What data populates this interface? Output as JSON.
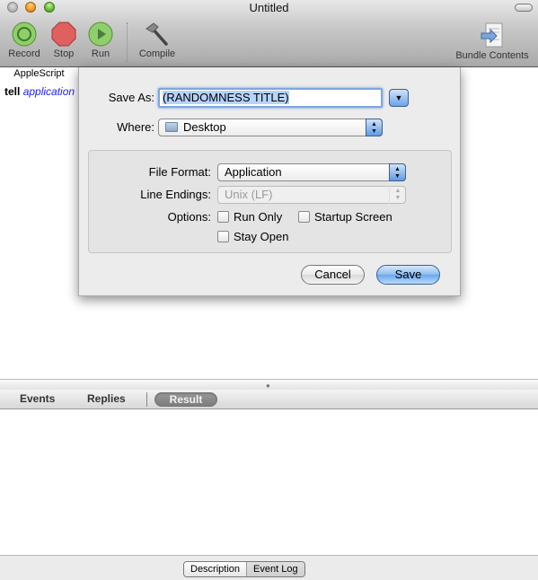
{
  "window": {
    "title": "Untitled"
  },
  "toolbar": {
    "record_label": "Record",
    "stop_label": "Stop",
    "run_label": "Run",
    "compile_label": "Compile",
    "bundle_label": "Bundle Contents"
  },
  "editor": {
    "language": "AppleScript",
    "code_keyword": "tell",
    "code_rest": "application"
  },
  "save_sheet": {
    "save_as_label": "Save As:",
    "save_as_value": "(RANDOMNESS TITLE)",
    "where_label": "Where:",
    "where_value": "Desktop",
    "file_format_label": "File Format:",
    "file_format_value": "Application",
    "line_endings_label": "Line Endings:",
    "line_endings_value": "Unix (LF)",
    "options_label": "Options:",
    "options": [
      {
        "label": "Run Only",
        "checked": false
      },
      {
        "label": "Startup Screen",
        "checked": false
      },
      {
        "label": "Stay Open",
        "checked": false
      }
    ],
    "cancel_label": "Cancel",
    "save_label": "Save"
  },
  "log": {
    "tabs": [
      {
        "label": "Events",
        "active": false
      },
      {
        "label": "Replies",
        "active": false
      },
      {
        "label": "Result",
        "active": true
      }
    ]
  },
  "bottom": {
    "segments": [
      {
        "label": "Description",
        "selected": true
      },
      {
        "label": "Event Log",
        "selected": false
      }
    ]
  }
}
